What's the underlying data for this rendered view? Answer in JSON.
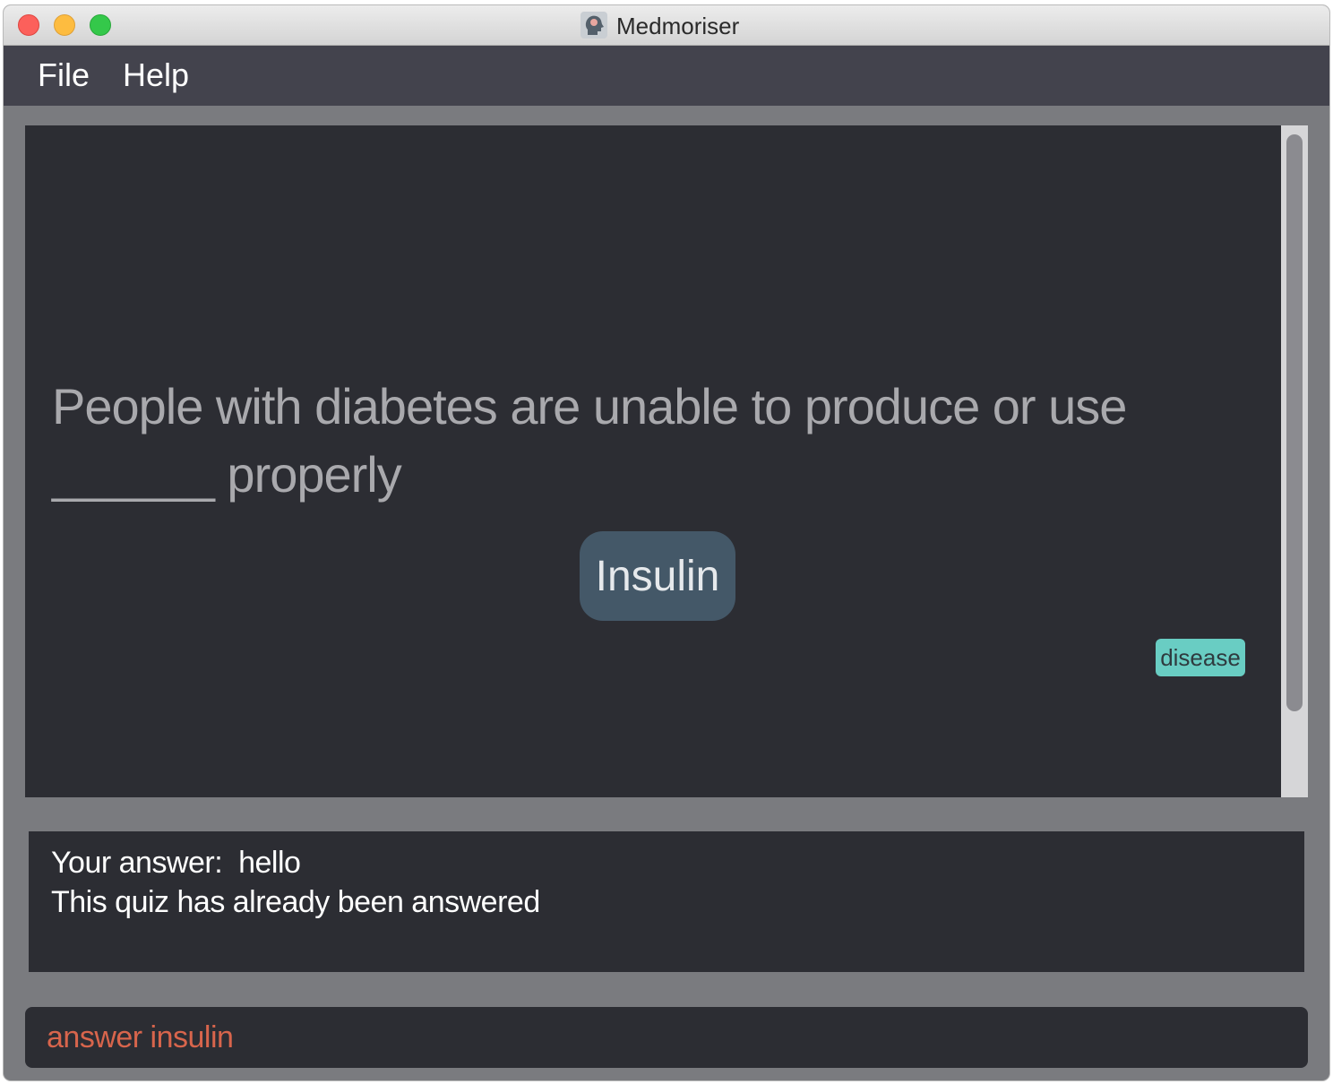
{
  "window": {
    "title": "Medmoriser",
    "app_icon": "head-with-brain-icon"
  },
  "menu": {
    "file": "File",
    "help": "Help"
  },
  "quiz": {
    "question": "People with diabetes are unable to produce or use ______ properly",
    "answer": "Insulin",
    "tag": "disease"
  },
  "result": {
    "answer_line": "Your answer:  hello",
    "status_line": "This quiz has already been answered"
  },
  "command_box": {
    "value": "answer insulin"
  },
  "colors": {
    "menubar": "#43434d",
    "card_bg": "#2c2d33",
    "answer_pill": "#445868",
    "tag_bg": "#69cdc3",
    "command_text": "#d8654c"
  }
}
